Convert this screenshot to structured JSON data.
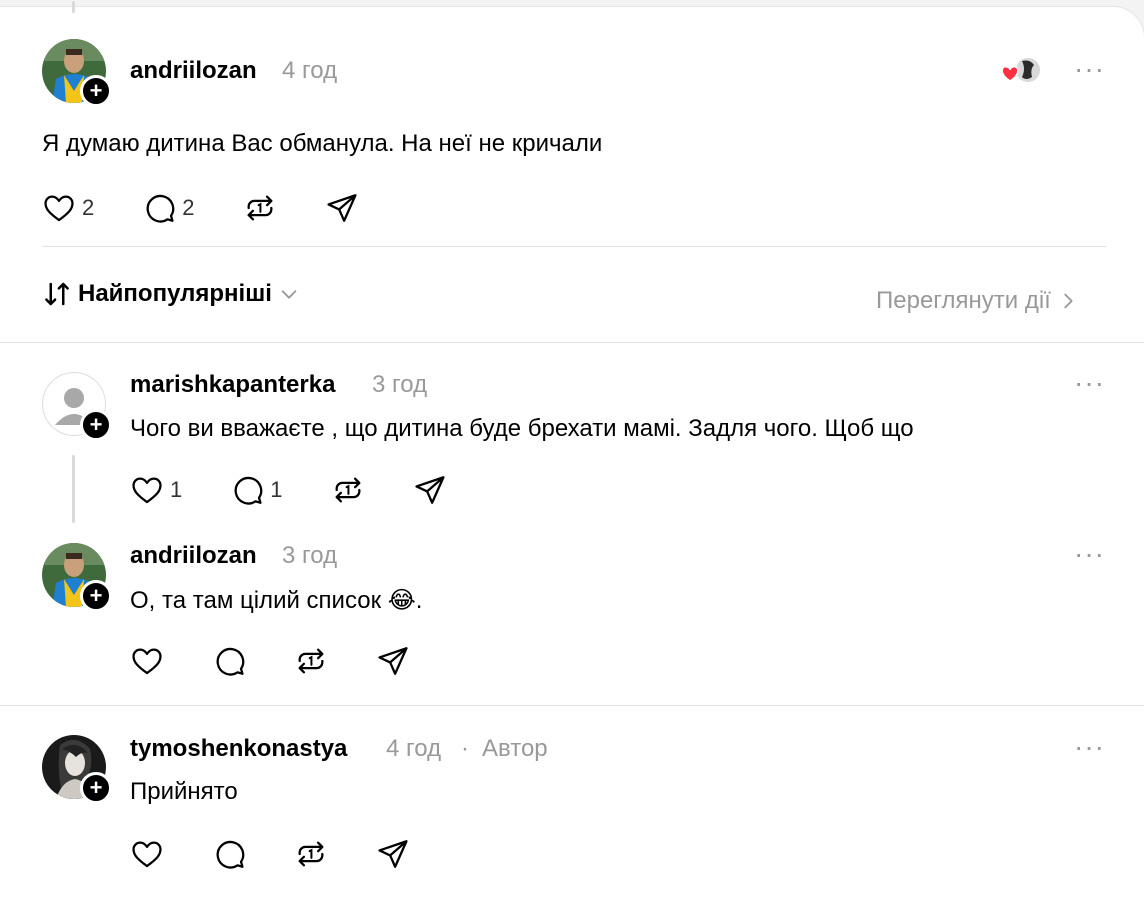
{
  "post": {
    "username": "andriilozan",
    "time": "4 год",
    "text": "Я думаю дитина Вас обманула. На неї не кричали",
    "like_count": "2",
    "reply_count": "2",
    "more_label": "···"
  },
  "sort": {
    "label": "Найпопулярніші"
  },
  "activity": {
    "label": "Переглянути дії"
  },
  "replies": [
    {
      "username": "marishkapanterka",
      "time": "3 год",
      "text": "Чого ви вважаєте , що дитина буде брехати мамі. Задля чого. Щоб що",
      "like_count": "1",
      "reply_count": "1"
    },
    {
      "username": "andriilozan",
      "time": "3 год",
      "text": "О, та там цілий список 😂."
    },
    {
      "username": "tymoshenkonastya",
      "time": "4 год",
      "separator": "·",
      "badge": "Автор",
      "text": "Прийнято"
    }
  ],
  "colors": {
    "background": "#ffffff",
    "muted": "#999999",
    "heart": "#ff3040",
    "divider": "#e2e2e2"
  }
}
